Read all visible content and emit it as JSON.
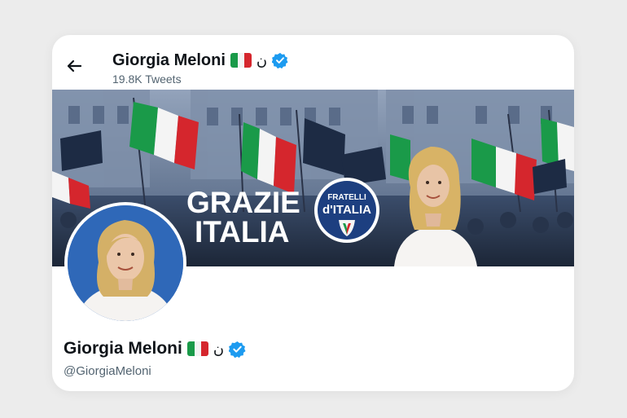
{
  "header": {
    "name": "Giorgia Meloni",
    "arabic_mark": "ن",
    "tweets_count": "19.8K Tweets"
  },
  "banner": {
    "headline_line1": "GRAZIE",
    "headline_line2": "ITALIA",
    "party_logo_line1": "FRATELLI",
    "party_logo_line2": "d'ITALIA"
  },
  "profile": {
    "name": "Giorgia Meloni",
    "arabic_mark": "ن",
    "handle": "@GiorgiaMeloni"
  },
  "icons": {
    "back": "arrow-left-icon",
    "flag": "italy-flag-icon",
    "verified": "verified-badge-icon"
  },
  "colors": {
    "verified_blue": "#1d9bf0",
    "flag_green": "#1a9a49",
    "flag_white": "#f4f4f4",
    "flag_red": "#d5262d",
    "party_blue": "#1d3f80"
  }
}
